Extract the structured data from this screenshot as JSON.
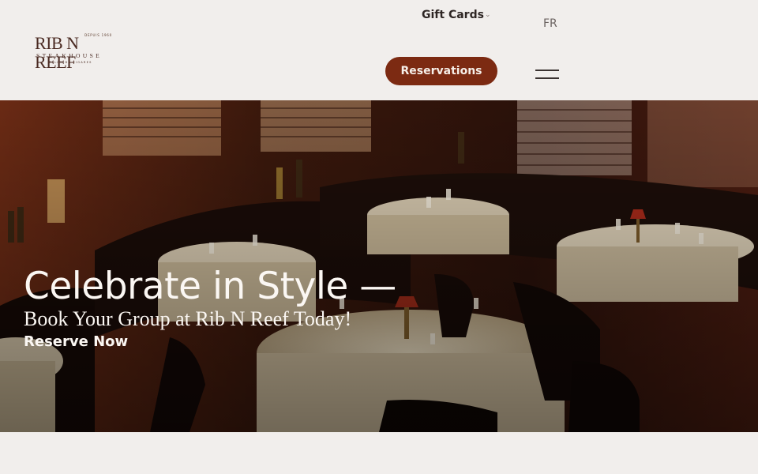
{
  "header": {
    "logo": {
      "brand": "RIB N REEF",
      "sub": "STEAKHOUSE",
      "tagline_top": "DEPUIS 1960",
      "tagline_bottom": "SALON DE CIGARES"
    },
    "gift_cards_label": "Gift Cards",
    "gift_caret_icon": "chevron-down-icon",
    "language_label": "FR",
    "reservations_label": "Reservations",
    "menu_icon": "hamburger-icon"
  },
  "hero": {
    "title": "Celebrate in Style —",
    "subtitle": "Book Your Group at Rib N Reef Today!",
    "cta": "Reserve Now"
  },
  "colors": {
    "background": "#f1eeec",
    "accent": "#7c2a12",
    "hero_text": "#fbf7f3"
  }
}
